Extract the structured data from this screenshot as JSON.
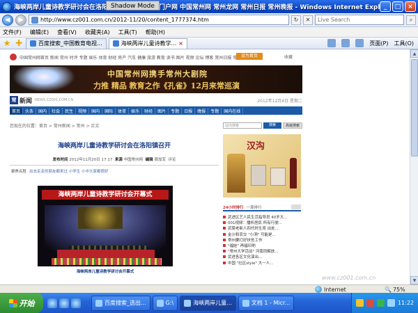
{
  "window": {
    "title": "海峡两岸儿童诗教学研讨会在洛阳镇召开 - 常州第一门户网 中国常州网 常州龙网 常州日报 常州晚报 - Windows Internet Explorer",
    "shadow_mode": "Shadow Mode",
    "min": "_",
    "max": "□",
    "close": "×"
  },
  "address": {
    "url": "http://www.cz001.com.cn/2012-11/20/content_1777374.htm",
    "search_placeholder": "Live Search"
  },
  "menu": [
    "文件(F)",
    "编辑(E)",
    "查看(V)",
    "收藏夹(A)",
    "工具(T)",
    "帮助(H)"
  ],
  "tabs": [
    {
      "label": "百度搜索_中国教育电视..."
    },
    {
      "label": "海峡两岸儿童诗教学..."
    }
  ],
  "command_bar": {
    "page": "页面(P)",
    "tools": "工具(O)"
  },
  "site": {
    "top_links": "中国常州网首页  新闻  常州  时评  专题  娱乐  体育  财经  房产  汽车  健康  旅游  教育  读书  图片  视频  论坛  博客  常州日报  常州晚报",
    "top_button": "设为首页",
    "top_right": "收藏",
    "banner_line1": "中国常州网携手常州大剧院",
    "banner_line2": "力推 精品 教育之作《孔雀》12月来常巡演",
    "logo_char": "常",
    "logo_text": "新闻",
    "domain": "NEWS.CZ001.COM.CN",
    "date": "2012年12月4日 星期二",
    "nav": [
      "首页",
      "头条",
      "国内",
      "社会",
      "民生",
      "视频",
      "国内",
      "国际",
      "体育",
      "娱乐",
      "财经",
      "图片",
      "专题",
      "日报",
      "晚报",
      "专题",
      "国内在线"
    ],
    "breadcrumb": "您现在的位置：首页 > 常州新闻 > 常州 > 正文",
    "mini_search_placeholder": "站内搜索",
    "mini_search_btn": "搜索",
    "mini_search_btn2": "高级搜索"
  },
  "article": {
    "title": "海峡两岸儿童诗教学研讨会在洛阳镇召开",
    "meta_label1": "发布时间",
    "meta_time": "2012年11月20日 17:17",
    "meta_label2": "来源",
    "meta_source": "中国常州网",
    "meta_label3": "编辑",
    "meta_editor": "周加军",
    "meta_comment": "评论",
    "related_label": "聚焦名胜",
    "related_links": "出去走走的朋友都来过 小学生 小中大家都很好",
    "photo_banner": "海峡两岸儿童诗教学研讨会开幕式",
    "photo_caption": "海峡两岸儿童诗教学研讨会开幕式"
  },
  "sidebar": {
    "ad_title": "汉沟",
    "rank_tabs": [
      "24小时排行",
      "一周排行"
    ],
    "rank_items": [
      "武进区艺人民生活指导员 40岁大...",
      "001视频：播析居民 所有行驶...",
      "武陵老新人四代时生育 出处...",
      "金沙和农交 \"小洞\" 可能是...",
      "常州要打好扶贫工作",
      "\"福娃\" 再福印刷",
      "\"常州大学活动\" 河南同解放...",
      "武进各区文化演出...",
      "中国 \"社区style\" 大一人..."
    ]
  },
  "watermark": "www.cz001.com.cn",
  "status": {
    "zone": "Internet",
    "zoom": "75%"
  },
  "taskbar": {
    "start": "开始",
    "tasks": [
      "百度搜索_选出...",
      "G:\\",
      "海峡两岸儿童...",
      "文档 1 - Micr..."
    ],
    "clock": "11:22"
  }
}
